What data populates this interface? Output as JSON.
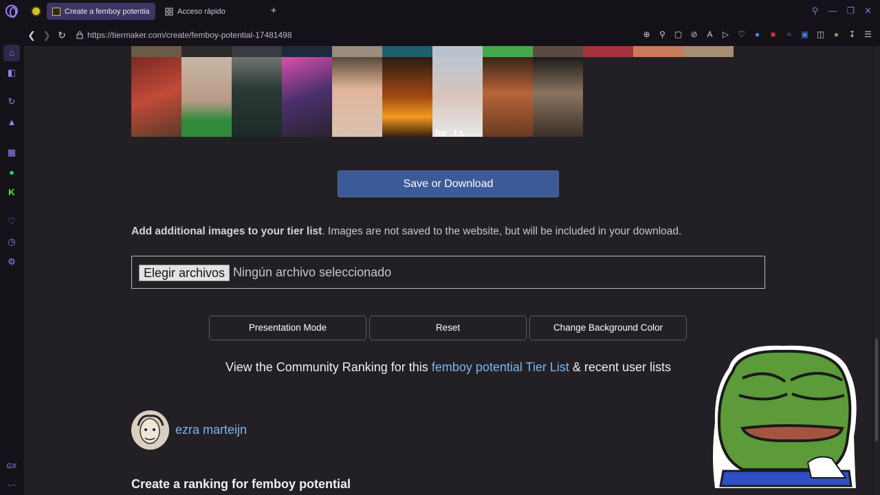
{
  "browser": {
    "tabs": [
      {
        "title": "Create a femboy potential"
      },
      {
        "title": "Acceso rápido"
      }
    ],
    "url": "https://tiermaker.com/create/femboy-potential-17481498"
  },
  "page": {
    "save_button": "Save or Download",
    "add_images_bold": "Add additional images to your tier list",
    "add_images_rest": ". Images are not saved to the website, but will be included in your download.",
    "file_button": "Elegir archivos",
    "file_status": "Ningún archivo seleccionado",
    "buttons": [
      "Presentation Mode",
      "Reset",
      "Change Background Color"
    ],
    "community_prefix": "View the Community Ranking for this ",
    "community_link": "femboy potential Tier List",
    "community_suffix": " & recent user lists",
    "author": "ezra marteijn",
    "heading": "Create a ranking for femboy potential",
    "tile_caption": "he is"
  },
  "colors": {
    "accent": "#9b7dff",
    "save_button": "#3d5a98",
    "link": "#7db5f0"
  }
}
